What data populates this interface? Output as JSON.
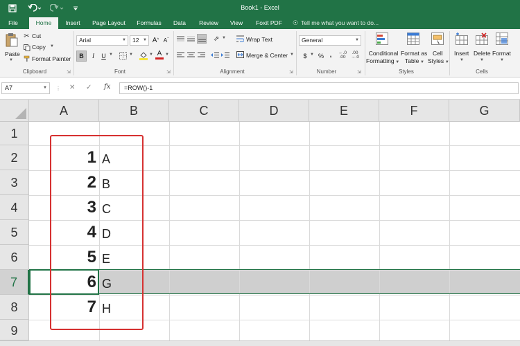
{
  "window": {
    "title": "Book1 - Excel"
  },
  "quick_access": {
    "save": "save-icon",
    "undo": "undo-icon",
    "redo": "redo-icon"
  },
  "tabs": [
    "File",
    "Home",
    "Insert",
    "Page Layout",
    "Formulas",
    "Data",
    "Review",
    "View",
    "Foxit PDF"
  ],
  "active_tab": "Home",
  "tell_me": "Tell me what you want to do...",
  "ribbon": {
    "clipboard": {
      "paste": "Paste",
      "cut": "Cut",
      "copy": "Copy",
      "format_painter": "Format Painter",
      "label": "Clipboard"
    },
    "font": {
      "name": "Arial",
      "size": "12",
      "bold": "B",
      "italic": "I",
      "underline": "U",
      "grow": "A",
      "shrink": "A",
      "font_color": "A",
      "label": "Font"
    },
    "alignment": {
      "wrap_text": "Wrap Text",
      "merge_center": "Merge & Center",
      "label": "Alignment"
    },
    "number": {
      "format": "General",
      "currency": "$",
      "percent": "%",
      "comma": ",",
      "label": "Number"
    },
    "styles": {
      "conditional": [
        "Conditional",
        "Formatting"
      ],
      "format_table": [
        "Format as",
        "Table"
      ],
      "cell_styles": [
        "Cell",
        "Styles"
      ],
      "label": "Styles"
    },
    "cells": {
      "insert": "Insert",
      "delete": "Delete",
      "format": "Format",
      "label": "Cells"
    }
  },
  "formula_bar": {
    "name_box": "A7",
    "cancel": "✕",
    "enter": "✓",
    "fx": "fx",
    "formula": "=ROW()-1"
  },
  "columns": [
    "A",
    "B",
    "C",
    "D",
    "E",
    "F",
    "G"
  ],
  "rows": [
    "1",
    "2",
    "3",
    "4",
    "5",
    "6",
    "7",
    "8",
    "9"
  ],
  "selected_row": "7",
  "active_cell": "A7",
  "cells": {
    "A": [
      "",
      "1",
      "2",
      "3",
      "4",
      "5",
      "6",
      "7",
      ""
    ],
    "B": [
      "",
      "A",
      "B",
      "C",
      "D",
      "E",
      "G",
      "H",
      ""
    ]
  },
  "colors": {
    "accent": "#217346",
    "highlight_box": "#d63131",
    "selected_row": "#cfcfcf"
  }
}
